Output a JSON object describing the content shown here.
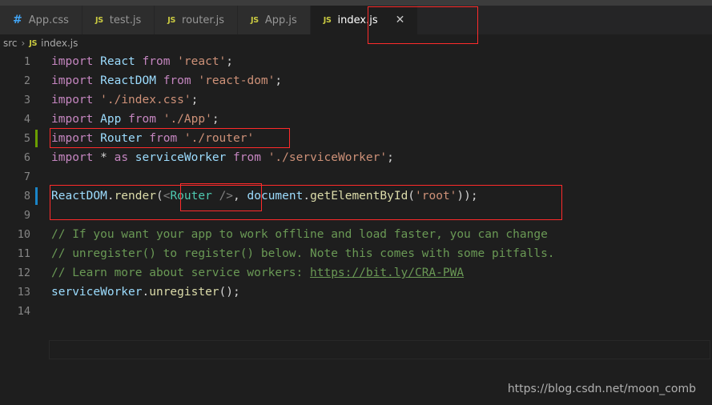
{
  "window": {
    "background": "#1e1e1e",
    "accent_red": "#ff2b2b"
  },
  "tabs": [
    {
      "label": "App.css",
      "icon": "css-file-icon",
      "icon_glyph": "#",
      "active": false,
      "closable": false
    },
    {
      "label": "test.js",
      "icon": "js-file-icon",
      "icon_glyph": "JS",
      "active": false,
      "closable": false
    },
    {
      "label": "router.js",
      "icon": "js-file-icon",
      "icon_glyph": "JS",
      "active": false,
      "closable": false
    },
    {
      "label": "App.js",
      "icon": "js-file-icon",
      "icon_glyph": "JS",
      "active": false,
      "closable": false
    },
    {
      "label": "index.js",
      "icon": "js-file-icon",
      "icon_glyph": "JS",
      "active": true,
      "closable": true,
      "close_glyph": "✕"
    }
  ],
  "breadcrumb": {
    "root": "src",
    "separator": "›",
    "file_icon_glyph": "JS",
    "file": "index.js"
  },
  "editor": {
    "lines": [
      {
        "n": "1",
        "gutter": "none"
      },
      {
        "n": "2",
        "gutter": "none"
      },
      {
        "n": "3",
        "gutter": "none"
      },
      {
        "n": "4",
        "gutter": "none"
      },
      {
        "n": "5",
        "gutter": "green"
      },
      {
        "n": "6",
        "gutter": "none"
      },
      {
        "n": "7",
        "gutter": "none"
      },
      {
        "n": "8",
        "gutter": "blue"
      },
      {
        "n": "9",
        "gutter": "none"
      },
      {
        "n": "10",
        "gutter": "none"
      },
      {
        "n": "11",
        "gutter": "none"
      },
      {
        "n": "12",
        "gutter": "none"
      },
      {
        "n": "13",
        "gutter": "none"
      },
      {
        "n": "14",
        "gutter": "none"
      }
    ],
    "code": {
      "l1": "import React from 'react';",
      "l2": "import ReactDOM from 'react-dom';",
      "l3": "import './index.css';",
      "l4": "import App from './App';",
      "l5": "import Router from './router'",
      "l6": "import * as serviceWorker from './serviceWorker';",
      "l7": "",
      "l8": "ReactDOM.render(<Router />, document.getElementById('root'));",
      "l9": "",
      "l10": "// If you want your app to work offline and load faster, you can change",
      "l11": "// unregister() to register() below. Note this comes with some pitfalls.",
      "l12": "// Learn more about service workers: https://bit.ly/CRA-PWA",
      "l13": "serviceWorker.unregister();",
      "l14": ""
    },
    "tokens": {
      "kw_import": "import",
      "kw_from": "from",
      "kw_as": "as",
      "id_react": "React",
      "id_reactdom": "ReactDOM",
      "id_app": "App",
      "id_router": "Router",
      "id_serviceworker": "serviceWorker",
      "id_document": "document",
      "str_react": "'react'",
      "str_reactdom": "'react-dom'",
      "str_indexcss": "'./index.css'",
      "str_app": "'./App'",
      "str_router": "'./router'",
      "str_serviceworker": "'./serviceWorker'",
      "str_root": "'root'",
      "fn_render": "render",
      "fn_getelementbyid": "getElementById",
      "fn_unregister": "unregister",
      "star": "*",
      "semi": ";",
      "tag_open": "<",
      "tag_close": "/>",
      "comment10": "// If you want your app to work offline and load faster, you can change",
      "comment11": "// unregister() to register() below. Note this comes with some pitfalls.",
      "comment12_prefix": "// Learn more about service workers: ",
      "comment12_link": "https://bit.ly/CRA-PWA"
    }
  },
  "annotations": [
    {
      "name": "active-tab-highlight",
      "color": "#ff2b2b"
    },
    {
      "name": "import-router-line-highlight",
      "color": "#ff2b2b"
    },
    {
      "name": "render-statement-highlight",
      "color": "#ff2b2b"
    },
    {
      "name": "router-element-highlight",
      "color": "#ff2b2b"
    }
  ],
  "watermark": {
    "text": "https://blog.csdn.net/moon_comb"
  }
}
